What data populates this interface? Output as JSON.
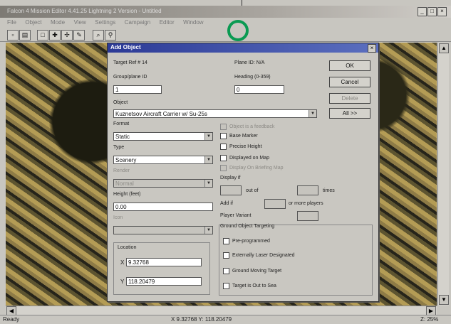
{
  "app": {
    "window_title": "Falcon 4 Mission Editor 4.41.25 Lightning 2 Version - Untitled",
    "menu": [
      "File",
      "Object",
      "Mode",
      "View",
      "Settings",
      "Campaign",
      "Editor",
      "Window"
    ],
    "window_buttons": [
      "_",
      "□",
      "×"
    ]
  },
  "toolbar": {
    "icons": [
      "new-icon",
      "open-icon",
      "select-icon",
      "add-object-icon",
      "search-icon",
      "zoom-icon"
    ]
  },
  "status": {
    "left": "Ready",
    "coords": "X 9.32768 Y: 118.20479",
    "zoom": "Z: 25%"
  },
  "dialog": {
    "title": "Add Object",
    "close": "×",
    "target_ref": "Target Ref # 14",
    "plane_id": "Plane ID: N/A",
    "group_label": "Group/plane ID",
    "group_value": "1",
    "heading_label": "Heading (0-359)",
    "heading_value": "0",
    "object_label": "Object",
    "object_value": "Kuznetsov Aircraft Carrier w/ Su-25s",
    "format_label": "Format",
    "format_value": "Static",
    "type_label": "Type",
    "type_value": "Scenery",
    "render_label": "Render",
    "render_value": "Normal",
    "height_label": "Height (feet)",
    "height_value": "0.00",
    "icon_label": "Icon",
    "icon_value": "",
    "location_label": "Location",
    "x_label": "X",
    "x_value": "9.32768",
    "y_label": "Y",
    "y_value": "118.20479",
    "buttons": {
      "ok": "OK",
      "cancel": "Cancel",
      "delete": "Delete",
      "all": "All >>"
    },
    "checks": {
      "feedback": "Object is a feedback",
      "base": "Base Marker",
      "precise": "Precise Height",
      "displayed": "Displayed on Map",
      "displayed_briefing": "Display On Briefing Map"
    },
    "display_if_label": "Display if",
    "out_of_label": "out of",
    "times_label": "times",
    "add_if_label": "Add if",
    "or_more_label": "or more players",
    "player_variant_label": "Player Variant",
    "ground_targeting_label": "Ground Object Targeting",
    "ground_checks": {
      "preprogrammed": "Pre-programmed",
      "laser": "Externally Laser Designated",
      "moving": "Ground Moving Target",
      "out_to_sea": "Target is Out to Sea"
    }
  }
}
